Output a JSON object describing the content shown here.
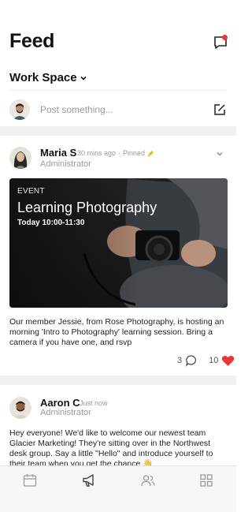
{
  "header": {
    "title": "Feed",
    "workspace_label": "Work Space",
    "composer_placeholder": "Post something..."
  },
  "posts": [
    {
      "author": "Maria S",
      "time": "30 mins ago",
      "pinned_label": "Pinned",
      "role": "Administrator",
      "event": {
        "tag": "EVENT",
        "title": "Learning Photography",
        "time": "Today 10:00-11:30"
      },
      "text": "Our member Jessie, from Rose Photography, is hosting an morning 'Intro to Photography' learning session. Bring a camera if you have one, and rsvp",
      "comments_count": "3",
      "likes_count": "10"
    },
    {
      "author": "Aaron C",
      "time": "Just now",
      "role": "Administrator",
      "text": "Hey everyone! We'd like to welcome our newest team Glacier Marketing! They're sitting over in the Northwest desk group. Say a little \"Hello\" and introduce yourself to their team when you get the chance 👋"
    }
  ],
  "tabbar": {
    "tabs": [
      "calendar-icon",
      "megaphone-icon",
      "people-icon",
      "grid-icon"
    ],
    "active_index": 1
  },
  "colors": {
    "notification_dot": "#e53935",
    "like_heart": "#e53935",
    "pin": "#f4b400",
    "feed_gap": "#f1f1f1"
  }
}
